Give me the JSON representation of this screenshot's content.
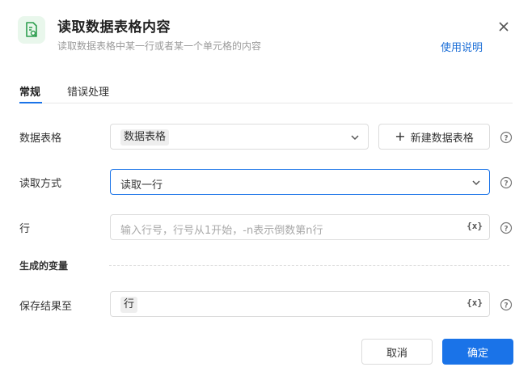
{
  "header": {
    "title": "读取数据表格内容",
    "subtitle": "读取数据表格中某一行或者某一个单元格的内容",
    "help_link": "使用说明",
    "icon": "document-search-icon",
    "icon_color": "#2e9e4f"
  },
  "tabs": [
    {
      "label": "常规",
      "active": true
    },
    {
      "label": "错误处理",
      "active": false
    }
  ],
  "fields": {
    "table": {
      "label": "数据表格",
      "value": "数据表格",
      "new_button": "新建数据表格"
    },
    "read_mode": {
      "label": "读取方式",
      "value": "读取一行"
    },
    "row": {
      "label": "行",
      "placeholder": "输入行号，行号从1开始，-n表示倒数第n行",
      "var_icon": "{x}"
    },
    "output_section": "生成的变量",
    "save_to": {
      "label": "保存结果至",
      "value": "行",
      "var_icon": "{x}"
    }
  },
  "footer": {
    "cancel": "取消",
    "confirm": "确定"
  },
  "colors": {
    "accent": "#1a73e8",
    "link": "#1a6dd6"
  }
}
